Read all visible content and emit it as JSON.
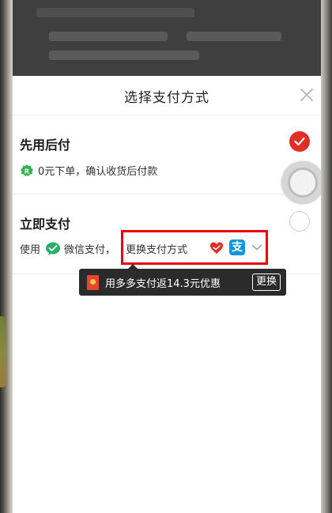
{
  "sheet": {
    "title": "选择支付方式"
  },
  "options": [
    {
      "title": "先用后付",
      "subtitle": "0元下单，确认收货后付款",
      "badge_icon": "credit-badge-icon",
      "selected": true
    },
    {
      "title": "立即支付",
      "use_prefix": "使用",
      "method_name": "微信支付，",
      "change_label": "更换支付方式",
      "selected": false
    }
  ],
  "promo": {
    "text": "用多多支付返14.3元优惠",
    "button_label": "更换"
  },
  "colors": {
    "accent_red": "#e02e24",
    "highlight_box": "#e60012",
    "wechat_green": "#2aae67",
    "alipay_blue": "#1296db"
  },
  "icons": {
    "close": "close-icon",
    "wechat": "wechat-pay-icon",
    "duoduo": "heart-icon",
    "alipay": "alipay-icon",
    "chevron": "chevron-down-icon"
  }
}
